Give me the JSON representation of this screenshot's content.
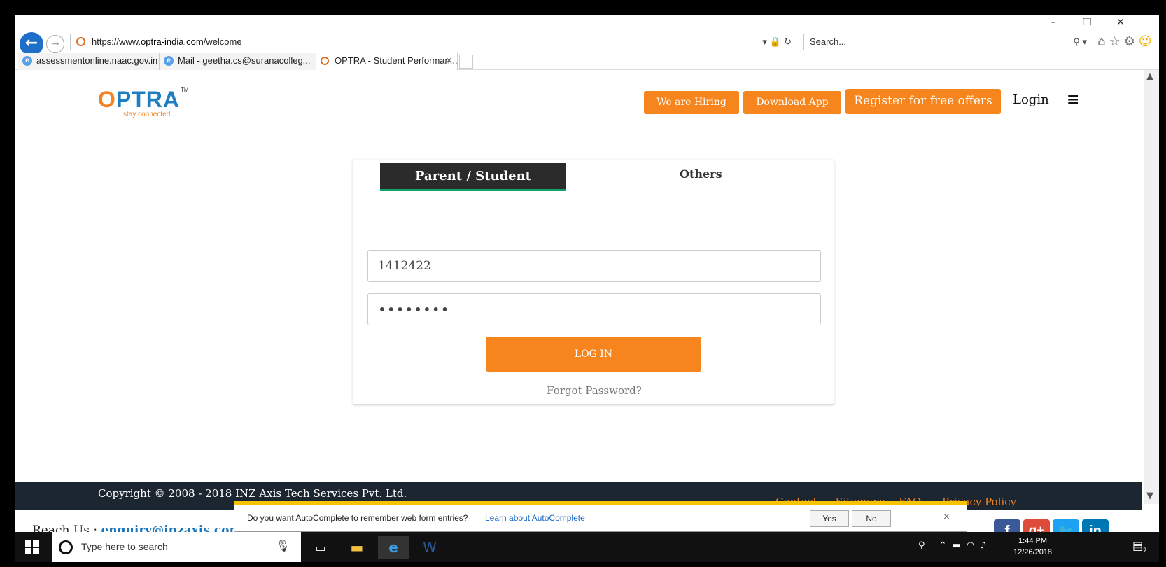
{
  "window": {
    "minimize": "–",
    "restore": "❐",
    "close": "✕"
  },
  "browser": {
    "url_prefix": "https://www.",
    "url_domain": "optra-india.com",
    "url_path": "/welcome",
    "search_placeholder": "Search...",
    "tabs": [
      {
        "label": "assessmentonline.naac.gov.in"
      },
      {
        "label": "Mail - geetha.cs@suranacolleg..."
      },
      {
        "label": "OPTRA - Student Performan..."
      }
    ]
  },
  "header": {
    "logo_text": "PTRA",
    "logo_o": "O",
    "logo_tm": "TM",
    "logo_tagline": "stay connected...",
    "hiring_label": "We are Hiring",
    "app_label": "Download App",
    "register_label": "Register for free offers",
    "login_label": "Login"
  },
  "login": {
    "tab_parent": "Parent / Student",
    "tab_others": "Others",
    "username_value": "1412422",
    "password_value": "••••••••",
    "login_button": "LOG IN",
    "forgot_label": "Forgot Password?"
  },
  "footer": {
    "copyright": "Copyright © 2008 - 2018  INZ Axis Tech Services Pvt. Ltd.",
    "links": [
      "Contact",
      "Sitemaps",
      "FAQ",
      "Privacy Policy"
    ],
    "reach_label": "Reach Us : ",
    "reach_email": "enquiry@inzaxis.com",
    "reach_sep": " /"
  },
  "autocomplete": {
    "message": "Do you want AutoComplete to remember web form entries?",
    "link": "Learn about AutoComplete",
    "yes": "Yes",
    "no": "No",
    "close": "×"
  },
  "taskbar": {
    "search_placeholder": "Type here to search",
    "time": "1:44 PM",
    "date": "12/26/2018",
    "notif_count": "2"
  },
  "colors": {
    "accent": "#f7851e",
    "brand_blue": "#1d7ec2",
    "footer_bg": "#1c2630"
  }
}
